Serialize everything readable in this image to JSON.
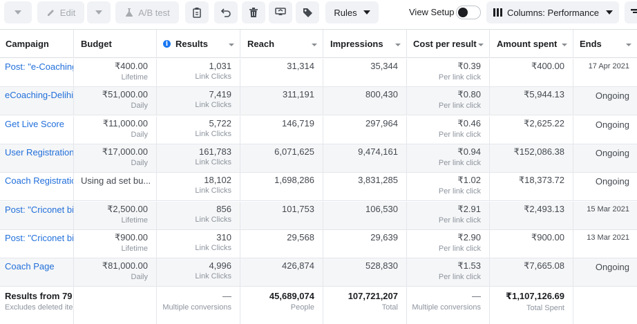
{
  "toolbar": {
    "edit_label": "Edit",
    "ab_test_label": "A/B test",
    "rules_label": "Rules",
    "view_setup_label": "View Setup",
    "columns_label": "Columns: Performance"
  },
  "columns": {
    "campaign": "Campaign",
    "budget": "Budget",
    "results": "Results",
    "reach": "Reach",
    "impressions": "Impressions",
    "cost_per_result": "Cost per result",
    "amount_spent": "Amount spent",
    "ends": "Ends"
  },
  "rows": [
    {
      "name": "Post: \"e-Coaching",
      "budget": "₹400.00",
      "budget_type": "Lifetime",
      "results": "1,031",
      "results_type": "Link Clicks",
      "reach": "31,314",
      "impressions": "35,344",
      "cpr": "₹0.39",
      "cpr_type": "Per link click",
      "spent": "₹400.00",
      "ends": "17 Apr 2021"
    },
    {
      "name": "eCoaching-Delihi",
      "budget": "₹51,000.00",
      "budget_type": "Daily",
      "results": "7,419",
      "results_type": "Link Clicks",
      "reach": "311,191",
      "impressions": "800,430",
      "cpr": "₹0.80",
      "cpr_type": "Per link click",
      "spent": "₹5,944.13",
      "ends": "Ongoing"
    },
    {
      "name": "Get Live Score",
      "budget": "₹11,000.00",
      "budget_type": "Daily",
      "results": "5,722",
      "results_type": "Link Clicks",
      "reach": "146,719",
      "impressions": "297,964",
      "cpr": "₹0.46",
      "cpr_type": "Per link click",
      "spent": "₹2,625.22",
      "ends": "Ongoing"
    },
    {
      "name": "User Registration",
      "budget": "₹17,000.00",
      "budget_type": "Daily",
      "results": "161,783",
      "results_type": "Link Clicks",
      "reach": "6,071,625",
      "impressions": "9,474,161",
      "cpr": "₹0.94",
      "cpr_type": "Per link click",
      "spent": "₹152,086.38",
      "ends": "Ongoing"
    },
    {
      "name": "Coach Registratio",
      "budget": "Using ad set bu...",
      "budget_type": "",
      "results": "18,102",
      "results_type": "Link Clicks",
      "reach": "1,698,286",
      "impressions": "3,831,285",
      "cpr": "₹1.02",
      "cpr_type": "Per link click",
      "spent": "₹18,373.72",
      "ends": "Ongoing"
    },
    {
      "name": "Post: \"Criconet bi",
      "budget": "₹2,500.00",
      "budget_type": "Lifetime",
      "results": "856",
      "results_type": "Link Clicks",
      "reach": "101,753",
      "impressions": "106,530",
      "cpr": "₹2.91",
      "cpr_type": "Per link click",
      "spent": "₹2,493.13",
      "ends": "15 Mar 2021"
    },
    {
      "name": "Post: \"Criconet bi",
      "budget": "₹900.00",
      "budget_type": "Lifetime",
      "results": "310",
      "results_type": "Link Clicks",
      "reach": "29,568",
      "impressions": "29,639",
      "cpr": "₹2.90",
      "cpr_type": "Per link click",
      "spent": "₹900.00",
      "ends": "13 Mar 2021"
    },
    {
      "name": "Coach Page",
      "budget": "₹81,000.00",
      "budget_type": "Daily",
      "results": "4,996",
      "results_type": "Link Clicks",
      "reach": "426,874",
      "impressions": "528,830",
      "cpr": "₹1.53",
      "cpr_type": "Per link click",
      "spent": "₹7,665.08",
      "ends": "Ongoing"
    }
  ],
  "totals": {
    "label": "Results from 79 c",
    "label_sub": "Excludes deleted ite",
    "results": "—",
    "results_sub": "Multiple conversions",
    "reach": "45,689,074",
    "reach_sub": "People",
    "impressions": "107,721,207",
    "impressions_sub": "Total",
    "cpr": "—",
    "cpr_sub": "Multiple conversions",
    "spent": "₹1,107,126.69",
    "spent_sub": "Total Spent"
  },
  "icons": [
    "chevron-down-icon",
    "pencil-icon",
    "flask-icon",
    "clipboard-icon",
    "undo-icon",
    "trash-icon",
    "duplicate-icon",
    "tag-icon",
    "columns-icon",
    "filter-icon",
    "info-icon"
  ]
}
